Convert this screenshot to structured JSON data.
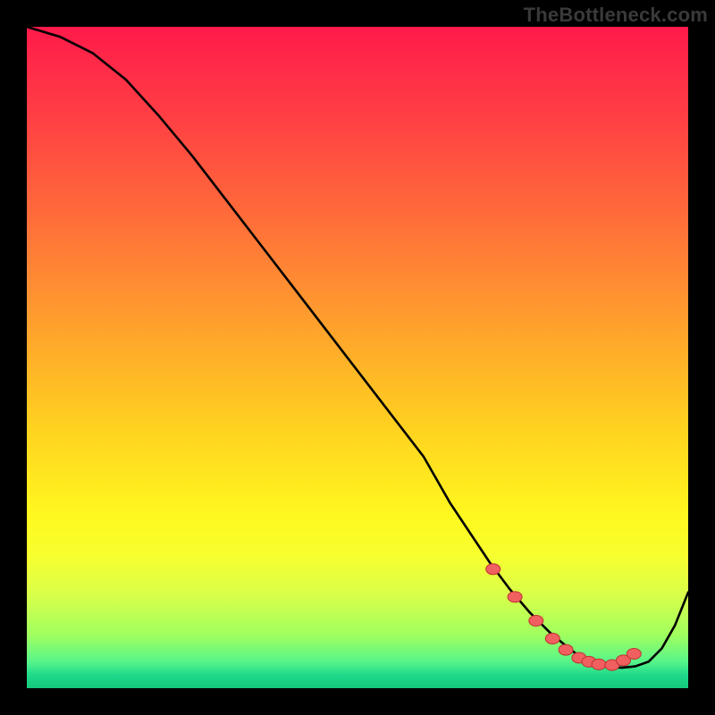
{
  "watermark": "TheBottleneck.com",
  "chart_data": {
    "type": "line",
    "title": "",
    "xlabel": "",
    "ylabel": "",
    "xlim": [
      0,
      100
    ],
    "ylim": [
      0,
      100
    ],
    "grid": false,
    "legend": false,
    "annotations": [],
    "series": [
      {
        "name": "curve",
        "x": [
          0,
          5,
          10,
          15,
          20,
          25,
          30,
          35,
          40,
          45,
          50,
          55,
          60,
          62,
          64,
          67,
          70,
          73,
          76,
          79,
          82,
          84,
          86,
          88,
          90,
          92,
          94,
          96,
          98,
          100
        ],
        "y": [
          100.0,
          98.5,
          96.0,
          92.0,
          86.5,
          80.5,
          74.0,
          67.5,
          61.0,
          54.5,
          48.0,
          41.5,
          35.0,
          31.5,
          28.0,
          23.5,
          19.0,
          15.0,
          11.5,
          8.5,
          6.0,
          4.5,
          3.5,
          3.2,
          3.1,
          3.3,
          4.0,
          6.0,
          9.5,
          14.5
        ]
      }
    ],
    "markers": {
      "name": "dots",
      "x": [
        70.5,
        73.8,
        77.0,
        79.5,
        81.5,
        83.5,
        85.0,
        86.5,
        88.5,
        90.2,
        91.8
      ],
      "y": [
        18.0,
        13.8,
        10.2,
        7.5,
        5.8,
        4.6,
        4.0,
        3.6,
        3.5,
        4.2,
        5.2
      ],
      "color": "#f06060",
      "stroke": "#c03030"
    },
    "gradient_stops": [
      {
        "pos": 0.0,
        "color": "#ff1a4a"
      },
      {
        "pos": 0.28,
        "color": "#ff6a3a"
      },
      {
        "pos": 0.5,
        "color": "#ffb028"
      },
      {
        "pos": 0.74,
        "color": "#fff81f"
      },
      {
        "pos": 0.92,
        "color": "#9fff5f"
      },
      {
        "pos": 1.0,
        "color": "#15c97c"
      }
    ]
  }
}
